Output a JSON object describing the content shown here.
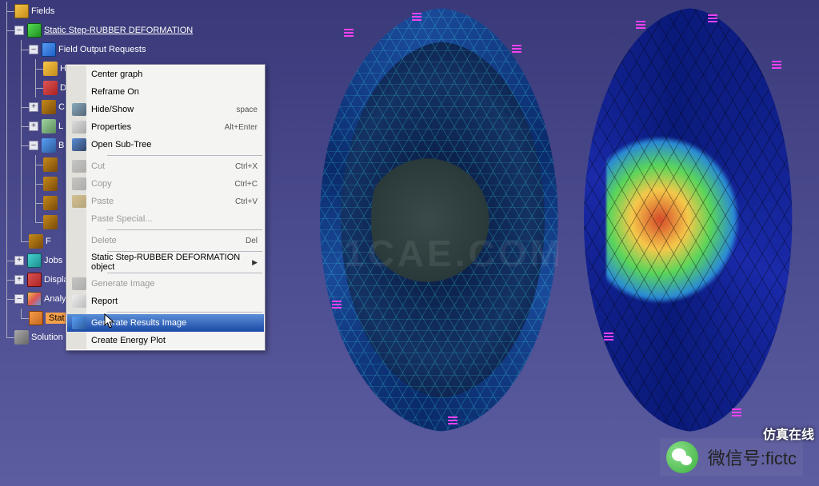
{
  "tree": {
    "fields_partial": "Fields",
    "step": "Static Step-RUBBER DEFORMATION",
    "field_output": "Field Output Requests",
    "h": "H",
    "d": "D",
    "c": "C",
    "l": "L",
    "b": "B",
    "f": "F",
    "jobs": "Jobs",
    "display": "Displa",
    "analysis": "Analy",
    "static_sel": "Stat",
    "sensors": "Solution Sensors"
  },
  "menu": {
    "center_graph": "Center graph",
    "reframe_on": "Reframe On",
    "hide_show": "Hide/Show",
    "hide_show_short": "space",
    "properties": "Properties",
    "properties_short": "Alt+Enter",
    "open_subtree": "Open Sub-Tree",
    "cut": "Cut",
    "cut_short": "Ctrl+X",
    "copy": "Copy",
    "copy_short": "Ctrl+C",
    "paste": "Paste",
    "paste_short": "Ctrl+V",
    "paste_special": "Paste Special...",
    "delete": "Delete",
    "delete_short": "Del",
    "step_object": "Static Step-RUBBER DEFORMATION object",
    "generate_image": "Generate Image",
    "report": "Report",
    "generate_results_image": "Generate Results Image",
    "create_energy_plot": "Create Energy Plot"
  },
  "footer": {
    "label": "微信号:fictc",
    "brand": "仿真在线"
  },
  "watermark": "1CAE.COM"
}
